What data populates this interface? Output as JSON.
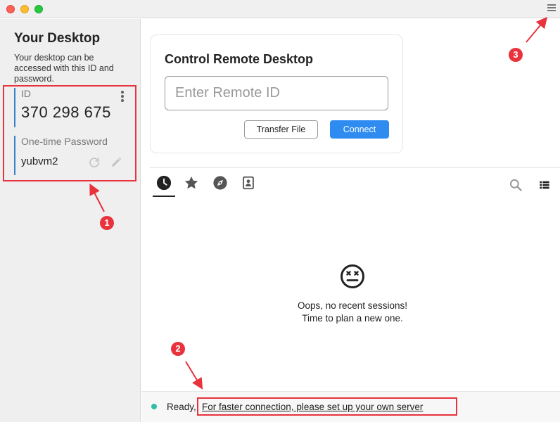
{
  "window": {
    "traffic_lights": [
      "close",
      "minimize",
      "zoom"
    ]
  },
  "sidebar": {
    "title": "Your Desktop",
    "description": "Your desktop can be accessed with this ID and password.",
    "id_label": "ID",
    "id_value": "370 298 675",
    "password_label": "One-time Password",
    "password_value": "yubvm2"
  },
  "connect": {
    "title": "Control Remote Desktop",
    "input_placeholder": "Enter Remote ID",
    "transfer_label": "Transfer File",
    "connect_label": "Connect"
  },
  "tabs": [
    {
      "name": "recent-sessions",
      "icon": "clock-icon",
      "active": true
    },
    {
      "name": "favorites",
      "icon": "star-icon",
      "active": false
    },
    {
      "name": "discovered",
      "icon": "compass-icon",
      "active": false
    },
    {
      "name": "address-book",
      "icon": "contact-book-icon",
      "active": false
    }
  ],
  "empty_state": {
    "line1": "Oops, no recent sessions!",
    "line2": "Time to plan a new one."
  },
  "status": {
    "ready": "Ready,",
    "link": "For faster connection, please set up your own server"
  },
  "annotations": {
    "badge1": "1",
    "badge2": "2",
    "badge3": "3",
    "color": "#e8323c"
  },
  "colors": {
    "accent": "#2e8bf0",
    "status_dot": "#32bea6",
    "sidebar_bg": "#efefef"
  }
}
